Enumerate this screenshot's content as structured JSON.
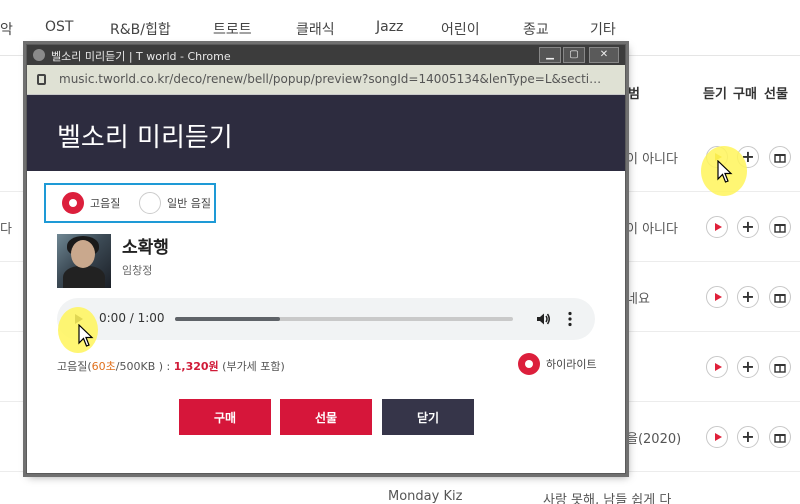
{
  "genre_nav": [
    "악",
    "OST",
    "R&B/힙합",
    "트로트",
    "클래식",
    "Jazz",
    "어린이",
    "종교",
    "기타"
  ],
  "list_header": {
    "album_fragment": "범",
    "listen": "듣기",
    "buy": "구매",
    "gift": "선물"
  },
  "list_rows": [
    {
      "left": "",
      "title": "이 아니다"
    },
    {
      "left": "다",
      "title": "이 아니다"
    },
    {
      "left": "",
      "title": "네요"
    },
    {
      "left": "",
      "title": ""
    },
    {
      "left": "",
      "title": "을(2020)"
    }
  ],
  "bottom_row": {
    "artist": "Monday Kiz",
    "title": "사랑 못해, 남들 쉽게 다"
  },
  "popup": {
    "window_title": "벨소리 미리듣기 | T world - Chrome",
    "url": "music.tworld.co.kr/deco/renew/bell/popup/preview?songId=14005134&lenType=L&secti…",
    "header_title": "벨소리 미리듣기",
    "quality_options": [
      {
        "label": "고음질",
        "selected": true
      },
      {
        "label": "일반 음질",
        "selected": false
      }
    ],
    "song": {
      "title": "소확행",
      "artist": "임창정"
    },
    "audio": {
      "time": "0:00 / 1:00",
      "progress_fraction": 0.31
    },
    "price": {
      "prefix": "고음질(",
      "duration": "60초",
      "size": "/500KB ) : ",
      "amount": "1,320원",
      "suffix": " (부가세 포함)"
    },
    "highlight_label": "하이라이트",
    "buttons": {
      "buy": "구매",
      "gift": "선물",
      "close": "닫기"
    }
  },
  "colors": {
    "accent_red": "#d6163a",
    "header_navy": "#2d2c3f",
    "close_button": "#363549",
    "quality_border": "#1e9ad6",
    "price_orange": "#e0701c"
  }
}
